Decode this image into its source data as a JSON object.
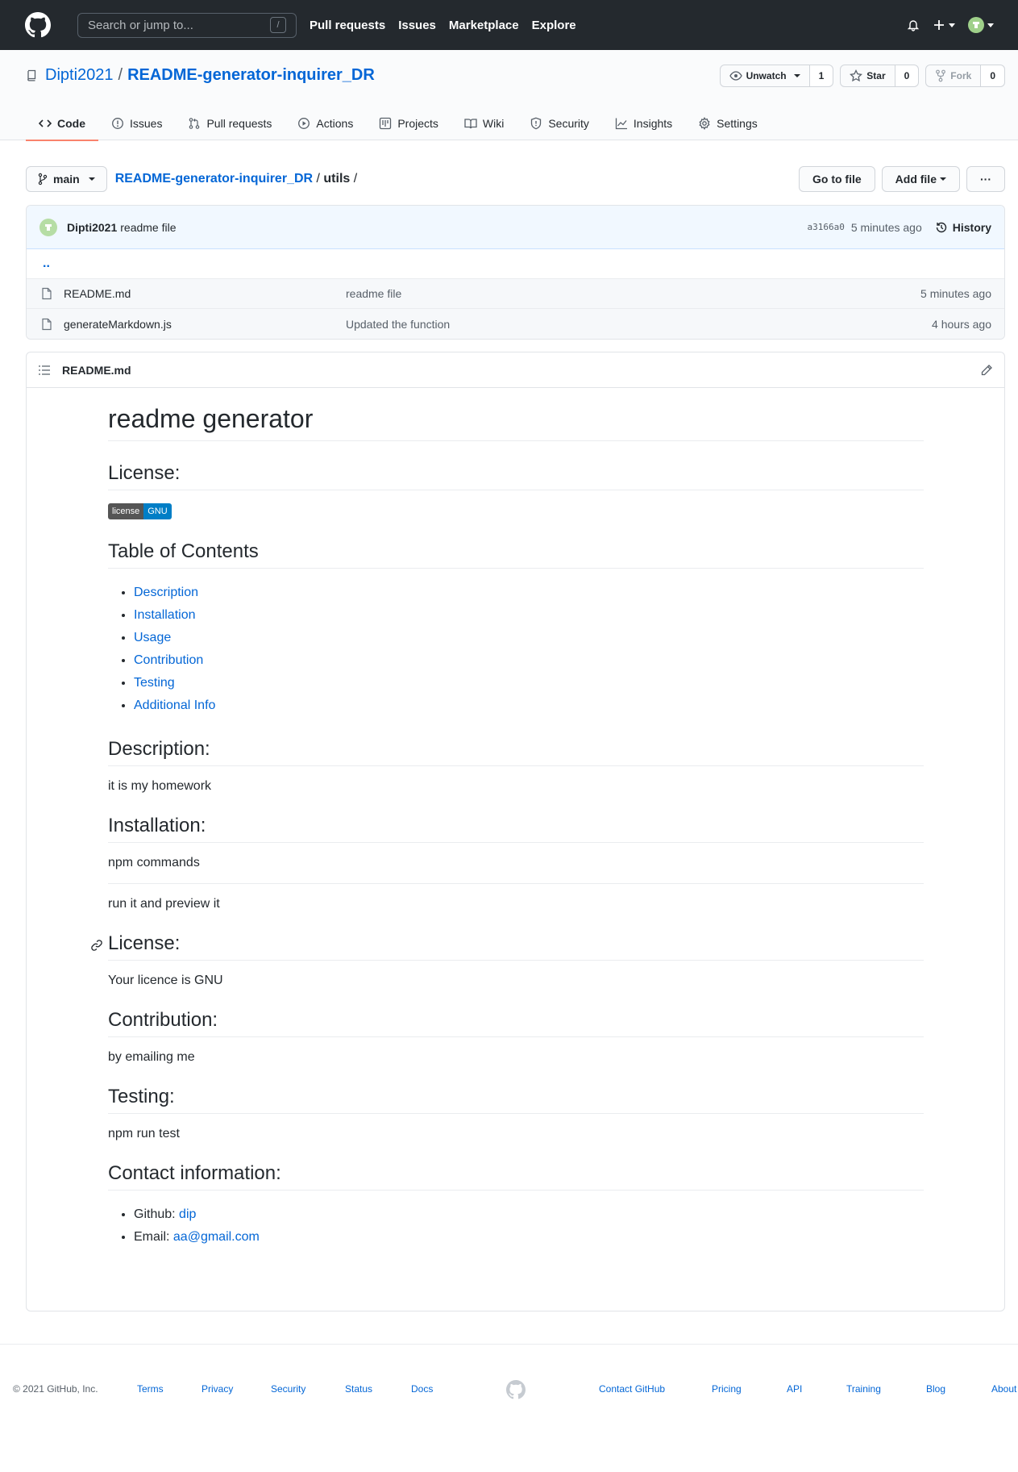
{
  "header": {
    "search_placeholder": "Search or jump to...",
    "slash_key": "/",
    "nav": [
      "Pull requests",
      "Issues",
      "Marketplace",
      "Explore"
    ]
  },
  "repo": {
    "owner": "Dipti2021",
    "separator": "/",
    "name": "README-generator-inquirer_DR",
    "unwatch_label": "Unwatch",
    "unwatch_count": "1",
    "star_label": "Star",
    "star_count": "0",
    "fork_label": "Fork",
    "fork_count": "0"
  },
  "tabs": [
    {
      "label": "Code",
      "icon": "code-icon"
    },
    {
      "label": "Issues",
      "icon": "issue-icon"
    },
    {
      "label": "Pull requests",
      "icon": "pull-request-icon"
    },
    {
      "label": "Actions",
      "icon": "play-icon"
    },
    {
      "label": "Projects",
      "icon": "project-icon"
    },
    {
      "label": "Wiki",
      "icon": "book-icon"
    },
    {
      "label": "Security",
      "icon": "shield-icon"
    },
    {
      "label": "Insights",
      "icon": "graph-icon"
    },
    {
      "label": "Settings",
      "icon": "gear-icon"
    }
  ],
  "filenav": {
    "branch": "main",
    "crumb_repo": "README-generator-inquirer_DR",
    "crumb_sep": "/",
    "crumb_dir": "utils",
    "crumb_end": "/",
    "go_to_file": "Go to file",
    "add_file": "Add file",
    "more": "···"
  },
  "commit": {
    "author": "Dipti2021",
    "message": "readme file",
    "sha": "a3166a0",
    "age": "5 minutes ago",
    "history": "History"
  },
  "files": {
    "up": "..",
    "rows": [
      {
        "name": "README.md",
        "message": "readme file",
        "age": "5 minutes ago"
      },
      {
        "name": "generateMarkdown.js",
        "message": "Updated the function",
        "age": "4 hours ago"
      }
    ]
  },
  "readme": {
    "filename": "README.md",
    "title": "readme generator",
    "license_heading": "License:",
    "badge_left": "license",
    "badge_right": "GNU",
    "toc_heading": "Table of Contents",
    "toc": [
      "Description",
      "Installation",
      "Usage",
      "Contribution",
      "Testing",
      "Additional Info"
    ],
    "description_heading": "Description:",
    "description": "it is my homework",
    "installation_heading": "Installation:",
    "installation": "npm commands",
    "usage": "run it and preview it",
    "license2_heading": "License:",
    "license_text": "Your licence is GNU",
    "contribution_heading": "Contribution:",
    "contribution": "by emailing me",
    "testing_heading": "Testing:",
    "testing": "npm run test",
    "contact_heading": "Contact information:",
    "github_label": "Github:",
    "github_value": "dip",
    "email_label": "Email:",
    "email_value": "aa@gmail.com"
  },
  "footer": {
    "copyright": "© 2021 GitHub, Inc.",
    "links_left": [
      "Terms",
      "Privacy",
      "Security",
      "Status",
      "Docs"
    ],
    "links_right": [
      "Contact GitHub",
      "Pricing",
      "API",
      "Training",
      "Blog",
      "About"
    ]
  },
  "colors": {
    "header_bg": "#24292e",
    "link": "#0366d6",
    "active_tab_underline": "#f9826c",
    "commit_bg": "#f1f8ff",
    "badge_right": "#007ec6"
  }
}
